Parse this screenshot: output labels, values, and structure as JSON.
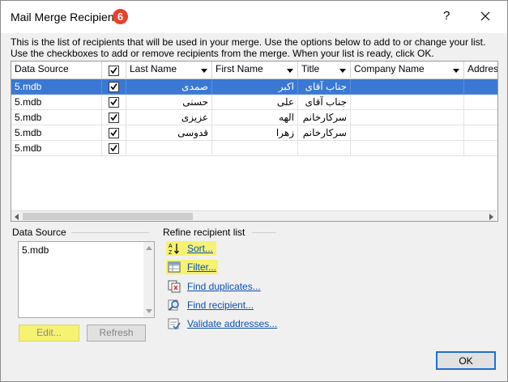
{
  "window": {
    "title": "Mail Merge Recipients",
    "badge": "6",
    "help": "?",
    "intro": "This is the list of recipients that will be used in your merge.  Use the options below to add to or change your list. Use the checkboxes to add or remove recipients from the merge.  When your list is ready, click OK."
  },
  "grid": {
    "columns": [
      "Data Source",
      "Last Name",
      "First Name",
      "Title",
      "Company Name",
      "Address"
    ],
    "rows": [
      {
        "source": "5.mdb",
        "checked": true,
        "last": "صمدی",
        "first": "اکبر",
        "title": "جناب آقای",
        "selected": true
      },
      {
        "source": "5.mdb",
        "checked": true,
        "last": "حسنی",
        "first": "علی",
        "title": "جناب آقای",
        "selected": false
      },
      {
        "source": "5.mdb",
        "checked": true,
        "last": "عزیزی",
        "first": "الهه",
        "title": "سرکارخانم",
        "selected": false
      },
      {
        "source": "5.mdb",
        "checked": true,
        "last": "قدوسی",
        "first": "زهرا",
        "title": "سرکارخانم",
        "selected": false
      },
      {
        "source": "5.mdb",
        "checked": true,
        "last": "",
        "first": "",
        "title": "",
        "selected": false
      }
    ]
  },
  "datasource": {
    "label": "Data Source",
    "items": [
      "5.mdb"
    ],
    "edit": "Edit...",
    "refresh": "Refresh"
  },
  "refine": {
    "label": "Refine recipient list",
    "sort": "Sort...",
    "filter": "Filter...",
    "duplicates": "Find duplicates...",
    "recipient": "Find recipient...",
    "validate": "Validate addresses..."
  },
  "ok": "OK",
  "colors": {
    "selection": "#3a78d4",
    "highlight": "#f6f272",
    "link": "#0b4fb4",
    "badge": "#e8412c"
  }
}
